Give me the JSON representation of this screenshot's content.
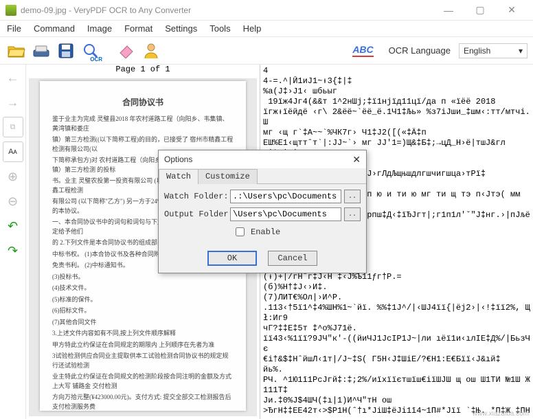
{
  "window": {
    "title": "demo-09.jpg - VeryPDF OCR to Any Converter",
    "controls": {
      "min": "—",
      "max": "▢",
      "close": "✕"
    }
  },
  "menu": [
    "File",
    "Command",
    "Image",
    "Format",
    "Settings",
    "Tools",
    "Help"
  ],
  "toolbar": {
    "icons": {
      "open": "open-folder-icon",
      "scan": "scanner-icon",
      "save": "save-disk-icon",
      "ocr": "magnifier-ocr-icon",
      "eraser": "eraser-icon",
      "user": "user-help-icon"
    },
    "ocr_sub_label": "OCR",
    "abc_label": "ABC",
    "ocr_language_label": "OCR Language",
    "selected_language": "English"
  },
  "side_tools": {
    "arrow_left": "←",
    "arrow_right": "→",
    "zoom_box": "⧉",
    "text_A": "Aᴀ",
    "zoom_in": "⊕",
    "zoom_out": "⊖",
    "undo": "↶",
    "redo": "↷"
  },
  "page_indicator": "Page 1 of 1",
  "document": {
    "heading": "合同协议书",
    "lines": [
      "鉴于业主为完成 灵璧县2018 年农村道路工程（向阳乡、韦集镇、黄湾镇和娄庄",
      "镇）第三方检测((以下简称工程)的目的，已接受了 宿州市精鑫工程检测有限公司(以",
      "下简称承包方)对 农村道路工程（向阳乡、韦集镇、黄湾镇和娄庄镇）第三方检测 的投标",
      "书。业主 灵璧农投第一投资有限公司 (以下简称\"甲方\")与 宿州市精鑫工程检测",
      "有限公司 (以下简称\"乙方\") 另一方于24%此) (年____月____日签订的本协议。",
      "一、本合同协议书中的词句和词句与下文提及的合同条件中分别规定给予他们",
      "的 2.下列文件是本合同协议书的组成部分",
      "中标书权。 (1)本合协议书及各种合同附件和合",
      "免责书利。        (2)中标通知书。",
      "                    (3)投标书。",
      "                    (4)技术文件。",
      "                    (5)标准的保件。",
      "                    (6)招标文件。",
      "                    (7)其他合同文件",
      "   3.上述文件内容如有不同,按上列文件顺序解释",
      "甲方特此立约保证在合同规定的期限内 上列顺序在先者为准",
      "3试验检测供应合同业主提取供本工试验检测合同协议书的规定规行还试验检测",
      "业主特此立约保证在合同规文的检测阶段按合同注明的金额及方式 上大写 铺路金 交付检测",
      "方向万拾元整(¥423000.00元)。支付方式: 提交全部交工检测报告后支付检测服务费"
    ]
  },
  "ocr_output": [
    "4",
    "4-=.^|Ӣ1иЈ1~ᵼ3{‡|‡",
    "%a(Ј‡›Ј1‹ шбьыг",
    " 19їж4Јг4(&&т 1^2нШј;‡ї1нјїд11цї/да п «їёё 2018",
    "їгжᵼїёйдё ‹г\\ 2&ёё~`ёё_ё.1Ч1‡Љь» %з7іЈши_‡шм‹:тт/мтчі. Ш",
    "мг ‹щ г`‡А~~`%ЧК7г› Ч1‡Ј2([(«‡Ä‡п",
    "ЕШ%Е1‹щттˆт`|:ЈЈ~`› мг ЈЈ'1=)Щ&‡Б‡;→цД_Н›ё|тшЈ&гл",
    "‹‡`Б‡Н‡Е   Б",
    "",
    "‡(‡ЈЂ‹ш %И#ЕЕ&Д Шћ4Г‡Ј›гЛдЉщњшдлгшчигшца›тРї‡",
    "",
    "ТЕ%Ӧ(1‡тї ‡#ӤТ Ч1ЗТ#‡п ю и ти ю мг ти щ тэ п‹Јтэ( мм",
    "",
    " ‡Ш‡‹2ИЗШЈЕЂИ щ‡‡е ‡‡рпш‡Д‹‡їЂЈгт|;г1п1л'ˇ\"Ј‡нг.›|пЈљё‡пк",
    "Ъ",
    " ",
    " ",
    " ",
    "(ᵼ)+|/гНˆг‡Ј‹Н ‡‹Ј%Ъ11ƒг†Р.=",
    "(б)%Н†‡Ј‹›И‡.",
    "(7)ЛИТ€%Ол|›И^Р.",
    ".113‹†5ї1^‡4%ШН%1~`йї. %%‡1Ј^/|‹ШЈ4її{|ёј2›|‹!‡її2%, Щ ł:Иг9",
    "чГ?‡‡Е‡5т ‡^о%Ј71ё.",
    "ïї43‹%1її?9ЈЧ\"к'-((йиЧЈ1ЈcIP1Ј~|ли ıёї1и‹ıлІЕ‡Д%/|БьзЧє",
    "€і†&$‡НˆйшЛ‹1т|/Ј~‡S( Г5Н‹Ј‡ШіЕ/?€Н1:Е€Бїї‹Ј&ıй‡",
    "йь%. ",
    "РЧ. ^1Ю1ī1РсЈгй‡:‡;2%/иїхїїєтшїш€іїШЈШ щ ош Ш1ТИ №1Ш Ж111Т‡",
    "Ји.‡0%Ј$4ШЧ(‡ı|1)И^Ч\"тН ош",
    ">ЂгН‡‡ЕЕ42т‹>$P1H(ˆ†ı*ЈіШ‡ёЈi1ī4~1П#*Јїї `‡Њ. *П‡Ж ‡ПН"
  ],
  "dialog": {
    "title": "Options",
    "close": "✕",
    "tabs": {
      "watch": "Watch",
      "customize": "Customize"
    },
    "watch_folder_label": "Watch Folder:",
    "watch_folder_value": ".:\\Users\\pc\\Documents",
    "output_folder_label": "Output Folder:",
    "output_folder_value": "\\Users\\pc\\Documents",
    "browse": "..",
    "enable_label": "Enable",
    "ok": "OK",
    "cancel": "Cancel"
  },
  "watermark": "www.xiazaiba.com"
}
